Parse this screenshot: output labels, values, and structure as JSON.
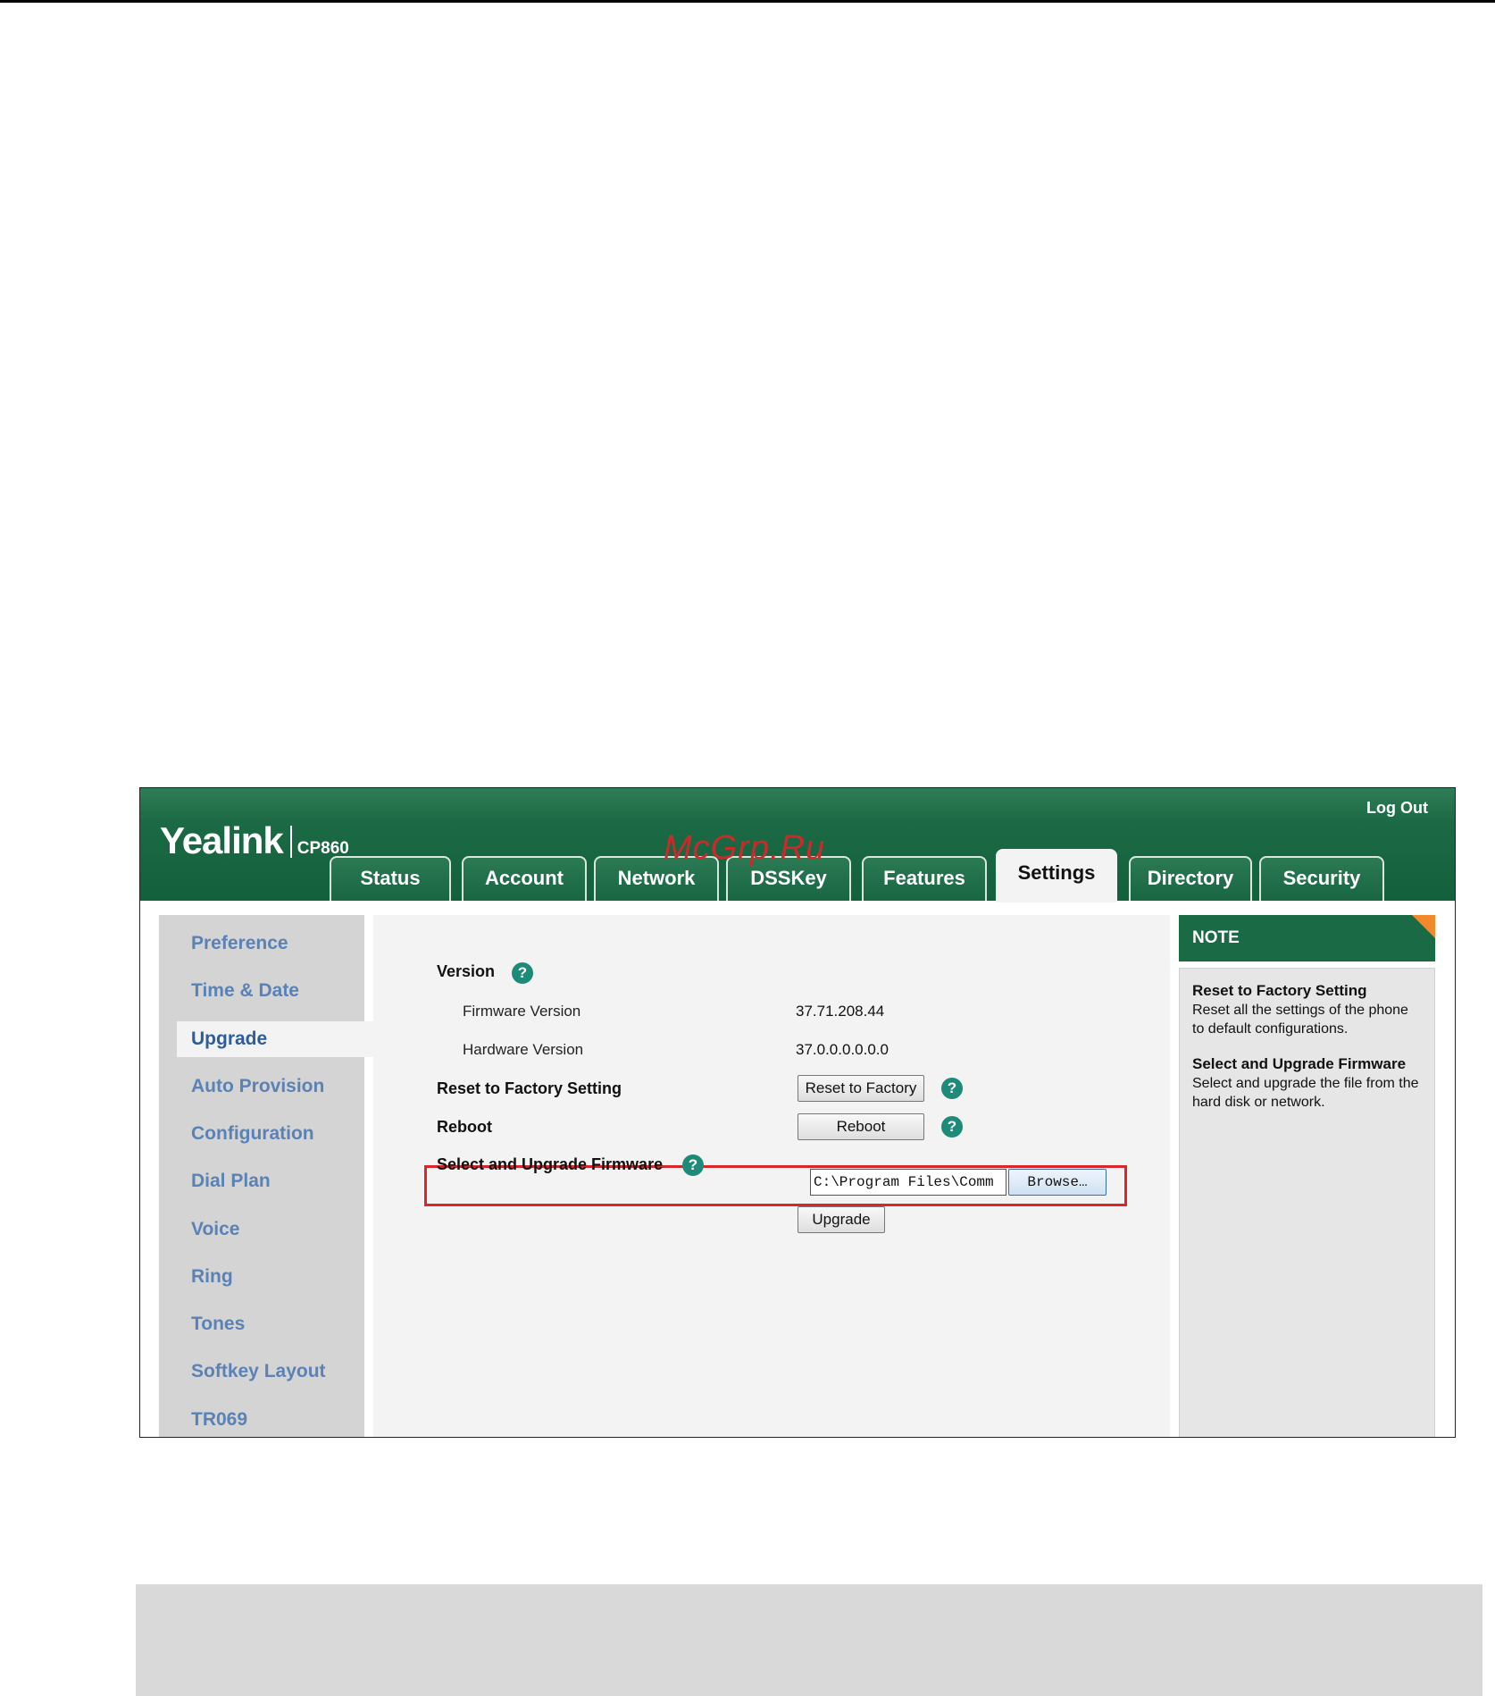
{
  "header": {
    "brand": "Yealink",
    "model": "CP860",
    "logout": "Log Out",
    "watermark": "McGrp.Ru"
  },
  "tabs": [
    {
      "label": "Status",
      "active": false
    },
    {
      "label": "Account",
      "active": false
    },
    {
      "label": "Network",
      "active": false
    },
    {
      "label": "DSSKey",
      "active": false
    },
    {
      "label": "Features",
      "active": false
    },
    {
      "label": "Settings",
      "active": true
    },
    {
      "label": "Directory",
      "active": false
    },
    {
      "label": "Security",
      "active": false
    }
  ],
  "sidebar": {
    "items": [
      {
        "label": "Preference"
      },
      {
        "label": "Time & Date"
      },
      {
        "label": "Upgrade",
        "active": true
      },
      {
        "label": "Auto Provision"
      },
      {
        "label": "Configuration"
      },
      {
        "label": "Dial Plan"
      },
      {
        "label": "Voice"
      },
      {
        "label": "Ring"
      },
      {
        "label": "Tones"
      },
      {
        "label": "Softkey Layout"
      },
      {
        "label": "TR069"
      }
    ]
  },
  "main": {
    "version_label": "Version",
    "firmware_label": "Firmware Version",
    "firmware_value": "37.71.208.44",
    "hardware_label": "Hardware Version",
    "hardware_value": "37.0.0.0.0.0.0",
    "reset_label": "Reset to Factory Setting",
    "reset_button": "Reset to Factory",
    "reboot_label": "Reboot",
    "reboot_button": "Reboot",
    "upgrade_label": "Select and Upgrade Firmware",
    "file_value": "C:\\Program Files\\Comm",
    "browse_button": "Browse…",
    "upgrade_button": "Upgrade",
    "help_glyph": "?"
  },
  "note": {
    "title": "NOTE",
    "items": [
      {
        "title": "Reset to Factory Setting",
        "text": "Reset all the settings of the phone to default configurations."
      },
      {
        "title": "Select and Upgrade Firmware",
        "text": "Select and upgrade the file from the hard disk or network."
      }
    ]
  },
  "colors": {
    "header_green": "#13613c",
    "nav_link": "#5b82b5",
    "help_teal": "#1d8a7a",
    "highlight_red": "#d9262b",
    "note_corner": "#f08a2c"
  },
  "icons": {
    "help": "help-icon",
    "note_corner": "note-corner-icon"
  }
}
